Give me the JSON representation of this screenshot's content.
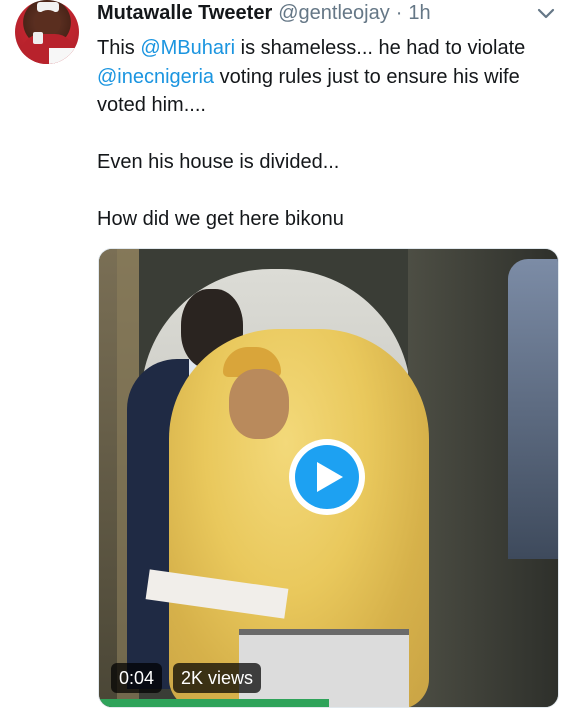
{
  "tweet": {
    "author_name": "Mutawalle Tweeter",
    "handle": "@gentleojay",
    "separator": "·",
    "time": "1h",
    "text": {
      "line1_prefix": "This ",
      "mention1": "@MBuhari",
      "line1_suffix": " is shameless... he had to violate ",
      "mention2": "@inecnigeria",
      "line1_end": " voting rules just to ensure his wife voted him....",
      "paragraph2": "Even his house is divided...",
      "paragraph3": "How did we get here bikonu"
    },
    "avatar_icon": "avatar",
    "menu_icon": "chevron-down-icon"
  },
  "media": {
    "type": "video",
    "play_icon": "play-icon",
    "duration": "0:04",
    "views": "2K views"
  },
  "colors": {
    "link": "#1b95e0",
    "text": "#14171a",
    "secondary": "#657786",
    "play": "#1da1f2"
  }
}
